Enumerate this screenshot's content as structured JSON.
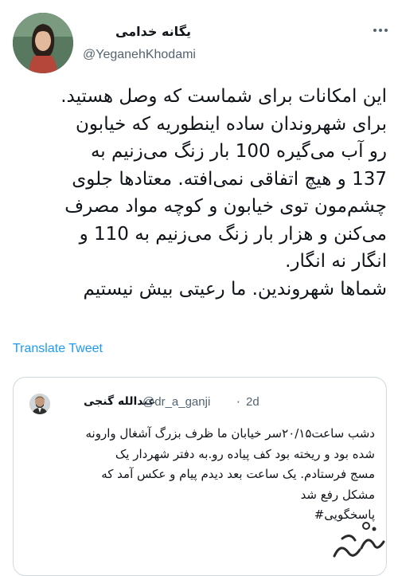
{
  "author": {
    "name": "یگانه خدامی",
    "handle": "@YeganehKhodami"
  },
  "tweet": {
    "text": "این امکانات برای شماست که وصل هستید.\nبرای شهروندان ساده اینطوریه که خیابون\nرو آب می‌گیره 100 بار زنگ می‌زنیم به\n137 و هیچ اتفاقی نمی‌افته. معتادها جلوی\nچشم‌مون توی خیابون و کوچه مواد مصرف\nمی‌کنن و هزار بار زنگ می‌زنیم به 110 و\nانگار نه انگار.\nشماها شهروندین. ما رعیتی بیش نیستیم",
    "translate_label": "Translate Tweet"
  },
  "quoted": {
    "name": "عبدالله گنجی",
    "handle": "@dr_a_ganji",
    "separator": "·",
    "time": "2d",
    "text": "دشب ساعت۲۰/۱۵سر خیابان ما ظرف بزرگ آشغال وارونه\nشده بود و ریخته بود کف پیاده رو.به دفتر شهردار یک\nمسج فرستادم. یک ساعت بعد دیدم پیام و عکس آمد که\nمشکل رفع شد\nپاسخگویی#"
  },
  "colors": {
    "link": "#1d9bf0",
    "secondary_text": "#536471",
    "border": "#cfd9de"
  },
  "icons": {
    "more": "more-horizontal-icon"
  }
}
